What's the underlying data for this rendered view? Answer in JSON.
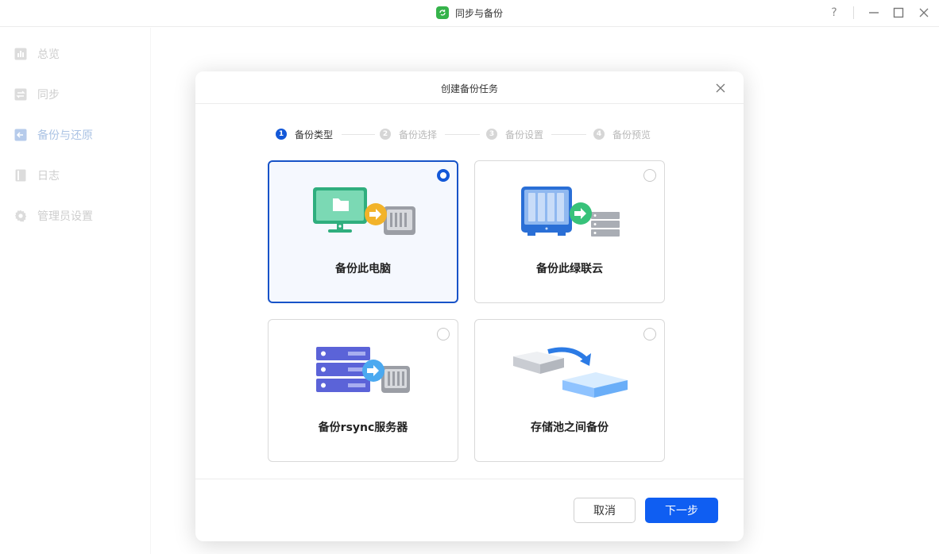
{
  "window": {
    "title": "同步与备份",
    "help_label": "?"
  },
  "sidebar": {
    "items": [
      {
        "label": "总览",
        "icon": "chart-icon"
      },
      {
        "label": "同步",
        "icon": "sync-icon"
      },
      {
        "label": "备份与还原",
        "icon": "backup-restore-icon",
        "active": true
      },
      {
        "label": "日志",
        "icon": "log-icon"
      },
      {
        "label": "管理员设置",
        "icon": "gear-icon"
      }
    ]
  },
  "modal": {
    "title": "创建备份任务",
    "steps": [
      {
        "num": "1",
        "label": "备份类型",
        "active": true
      },
      {
        "num": "2",
        "label": "备份选择"
      },
      {
        "num": "3",
        "label": "备份设置"
      },
      {
        "num": "4",
        "label": "备份预览"
      }
    ],
    "options": [
      {
        "label": "备份此电脑",
        "selected": true,
        "icon": "computer-to-nas-icon"
      },
      {
        "label": "备份此绿联云",
        "selected": false,
        "icon": "nas-to-server-icon"
      },
      {
        "label": "备份rsync服务器",
        "selected": false,
        "icon": "rsync-server-icon"
      },
      {
        "label": "存储池之间备份",
        "selected": false,
        "icon": "storage-pool-icon"
      }
    ],
    "buttons": {
      "cancel": "取消",
      "next": "下一步"
    }
  },
  "colors": {
    "primary": "#0f5ef2",
    "selected_border": "#1853c8",
    "app_icon": "#35b34a",
    "sidebar_active": "#7ea3d6"
  }
}
